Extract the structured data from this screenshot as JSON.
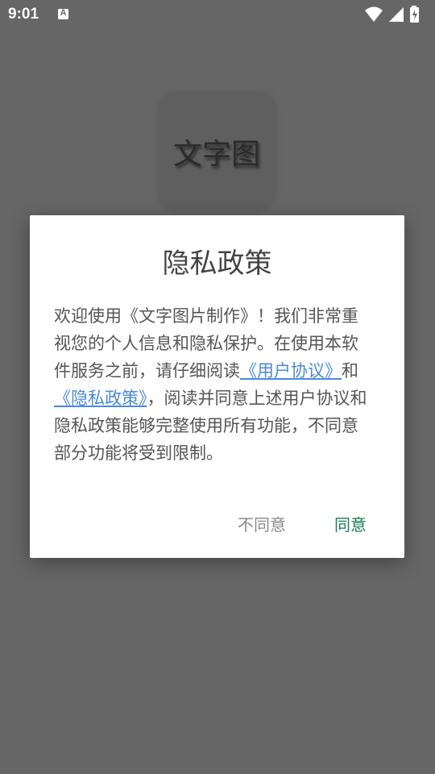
{
  "status_bar": {
    "time": "9:01",
    "notification_icon": "A",
    "icons": [
      "wifi-icon",
      "signal-icon",
      "battery-charging-icon"
    ]
  },
  "app": {
    "logo_text": "文字图"
  },
  "dialog": {
    "title": "隐私政策",
    "body_before_link1": "欢迎使用《文字图片制作》！我们非常重视您的个人信息和隐私保护。在使用本软件服务之前，请仔细阅读",
    "link_user_agreement": "《用户协议》",
    "body_between_links": "和",
    "link_privacy_policy": "《隐私政策》",
    "body_after_link2": "，阅读并同意上述用户协议和隐私政策能够完整使用所有功能，不同意部分功能将受到限制。",
    "disagree_label": "不同意",
    "agree_label": "同意"
  },
  "colors": {
    "scrim": "#666666",
    "link": "#4a8ad8",
    "agree": "#1a7a55",
    "disagree": "#8a8a8a"
  }
}
